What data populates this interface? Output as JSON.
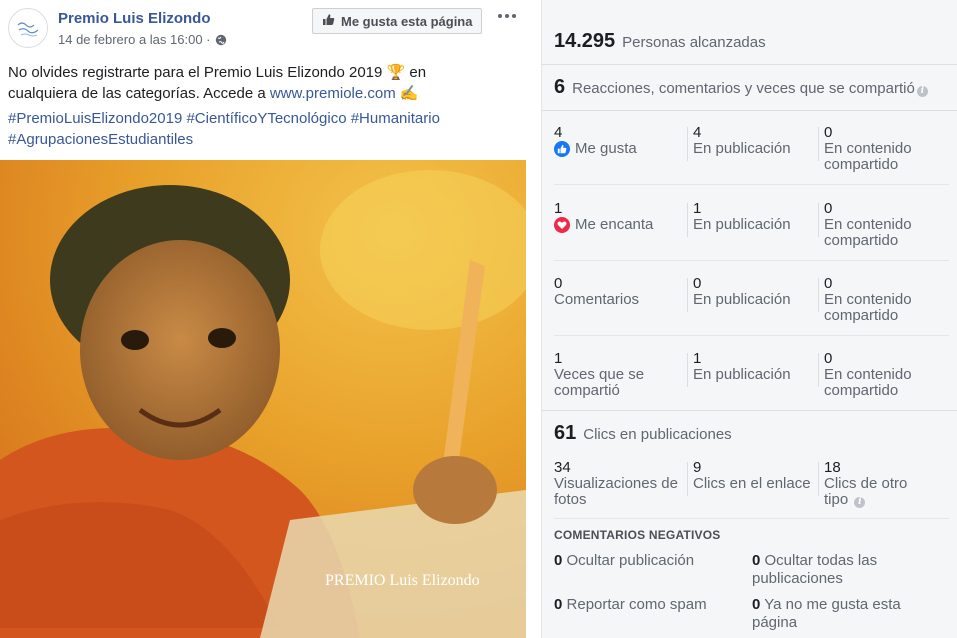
{
  "post": {
    "page_name": "Premio Luis Elizondo",
    "timestamp": "14 de febrero a las 16:00 ·",
    "like_page_label": "Me gusta esta página",
    "text_before_link": "No olvides registrarte para el Premio Luis Elizondo 2019 🏆 en cualquiera de las categorías. Accede a ",
    "link": "www.premiole.com",
    "text_after_link": " ✍️",
    "hashtags": "#PremioLuisElizondo2019 #CientíficoYTecnológico #Humanitario #AgrupacionesEstudiantiles",
    "image_logo_text": "PREMIO Luis Elizondo",
    "colors": {
      "link": "#385898",
      "image_overlay": "#e8a02a"
    }
  },
  "insights": {
    "reach": {
      "value": "14.295",
      "label": "Personas alcanzadas"
    },
    "reactions": {
      "value": "6",
      "label": "Reacciones, comentarios y veces que se compartió"
    },
    "rows": [
      {
        "main_value": "4",
        "main_label": "Me gusta",
        "icon": "like-icon",
        "pub_value": "4",
        "pub_label": "En publicación",
        "shared_value": "0",
        "shared_label": "En contenido compartido"
      },
      {
        "main_value": "1",
        "main_label": "Me encanta",
        "icon": "love-icon",
        "pub_value": "1",
        "pub_label": "En publicación",
        "shared_value": "0",
        "shared_label": "En contenido compartido"
      },
      {
        "main_value": "0",
        "main_label": "Comentarios",
        "pub_value": "0",
        "pub_label": "En publicación",
        "shared_value": "0",
        "shared_label": "En contenido compartido"
      },
      {
        "main_value": "1",
        "main_label": "Veces que se compartió",
        "pub_value": "1",
        "pub_label": "En publicación",
        "shared_value": "0",
        "shared_label": "En contenido compartido"
      }
    ],
    "clicks": {
      "value": "61",
      "label": "Clics en publicaciones"
    },
    "click_breakdown": [
      {
        "value": "34",
        "label": "Visualizaciones de fotos"
      },
      {
        "value": "9",
        "label": "Clics en el enlace"
      },
      {
        "value": "18",
        "label": "Clics de otro tipo"
      }
    ],
    "negative": {
      "title": "COMENTARIOS NEGATIVOS",
      "items": [
        {
          "value": "0",
          "label": "Ocultar publicación"
        },
        {
          "value": "0",
          "label": "Ocultar todas las publicaciones"
        },
        {
          "value": "0",
          "label": "Reportar como spam"
        },
        {
          "value": "0",
          "label": "Ya no me gusta esta página"
        }
      ]
    },
    "colors": {
      "like": "#1877f2",
      "love": "#f0284a",
      "panel_bg": "#f5f6f7"
    }
  }
}
